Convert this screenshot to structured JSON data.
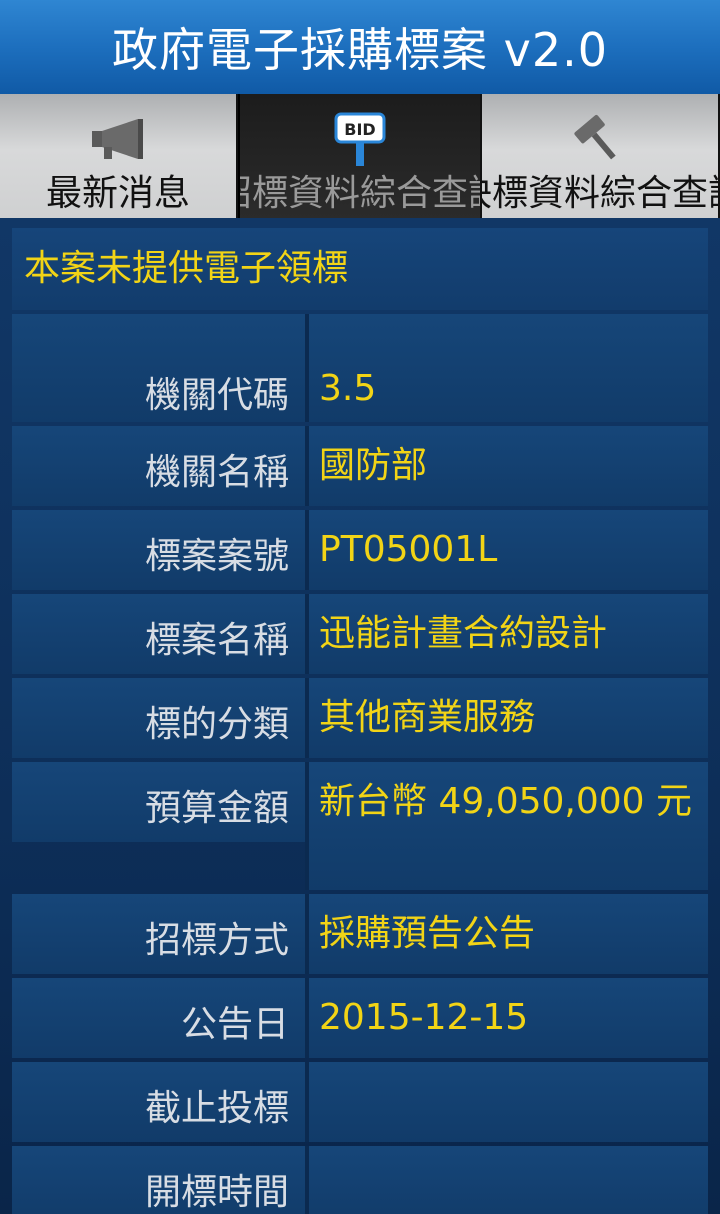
{
  "app": {
    "title": "政府電子採購標案 v2.0"
  },
  "tabs": [
    {
      "label": "最新消息",
      "icon": "megaphone-icon"
    },
    {
      "label": "招標資料綜合查詢",
      "icon": "bid-sign-icon",
      "icon_text": "BID"
    },
    {
      "label": "決標資料綜合查詢",
      "icon": "gavel-icon"
    }
  ],
  "notice": "本案未提供電子領標",
  "details": {
    "rows": [
      {
        "label": "機關代碼",
        "value": "3.5"
      },
      {
        "label": "機關名稱",
        "value": "國防部"
      },
      {
        "label": "標案案號",
        "value": "PT05001L"
      },
      {
        "label": "標案名稱",
        "value": "迅能計畫合約設計"
      },
      {
        "label": "標的分類",
        "value": "其他商業服務"
      },
      {
        "label": "預算金額",
        "value": "新台幣 49,050,000 元"
      },
      {
        "label": "招標方式",
        "value": "採購預告公告"
      },
      {
        "label": "公告日",
        "value": "2015-12-15"
      },
      {
        "label": "截止投標",
        "value": ""
      },
      {
        "label": "開標時間",
        "value": ""
      }
    ]
  },
  "colors": {
    "accent": "#f2d416",
    "title_bar": "#1d6fbe",
    "background": "#0d2e58"
  }
}
